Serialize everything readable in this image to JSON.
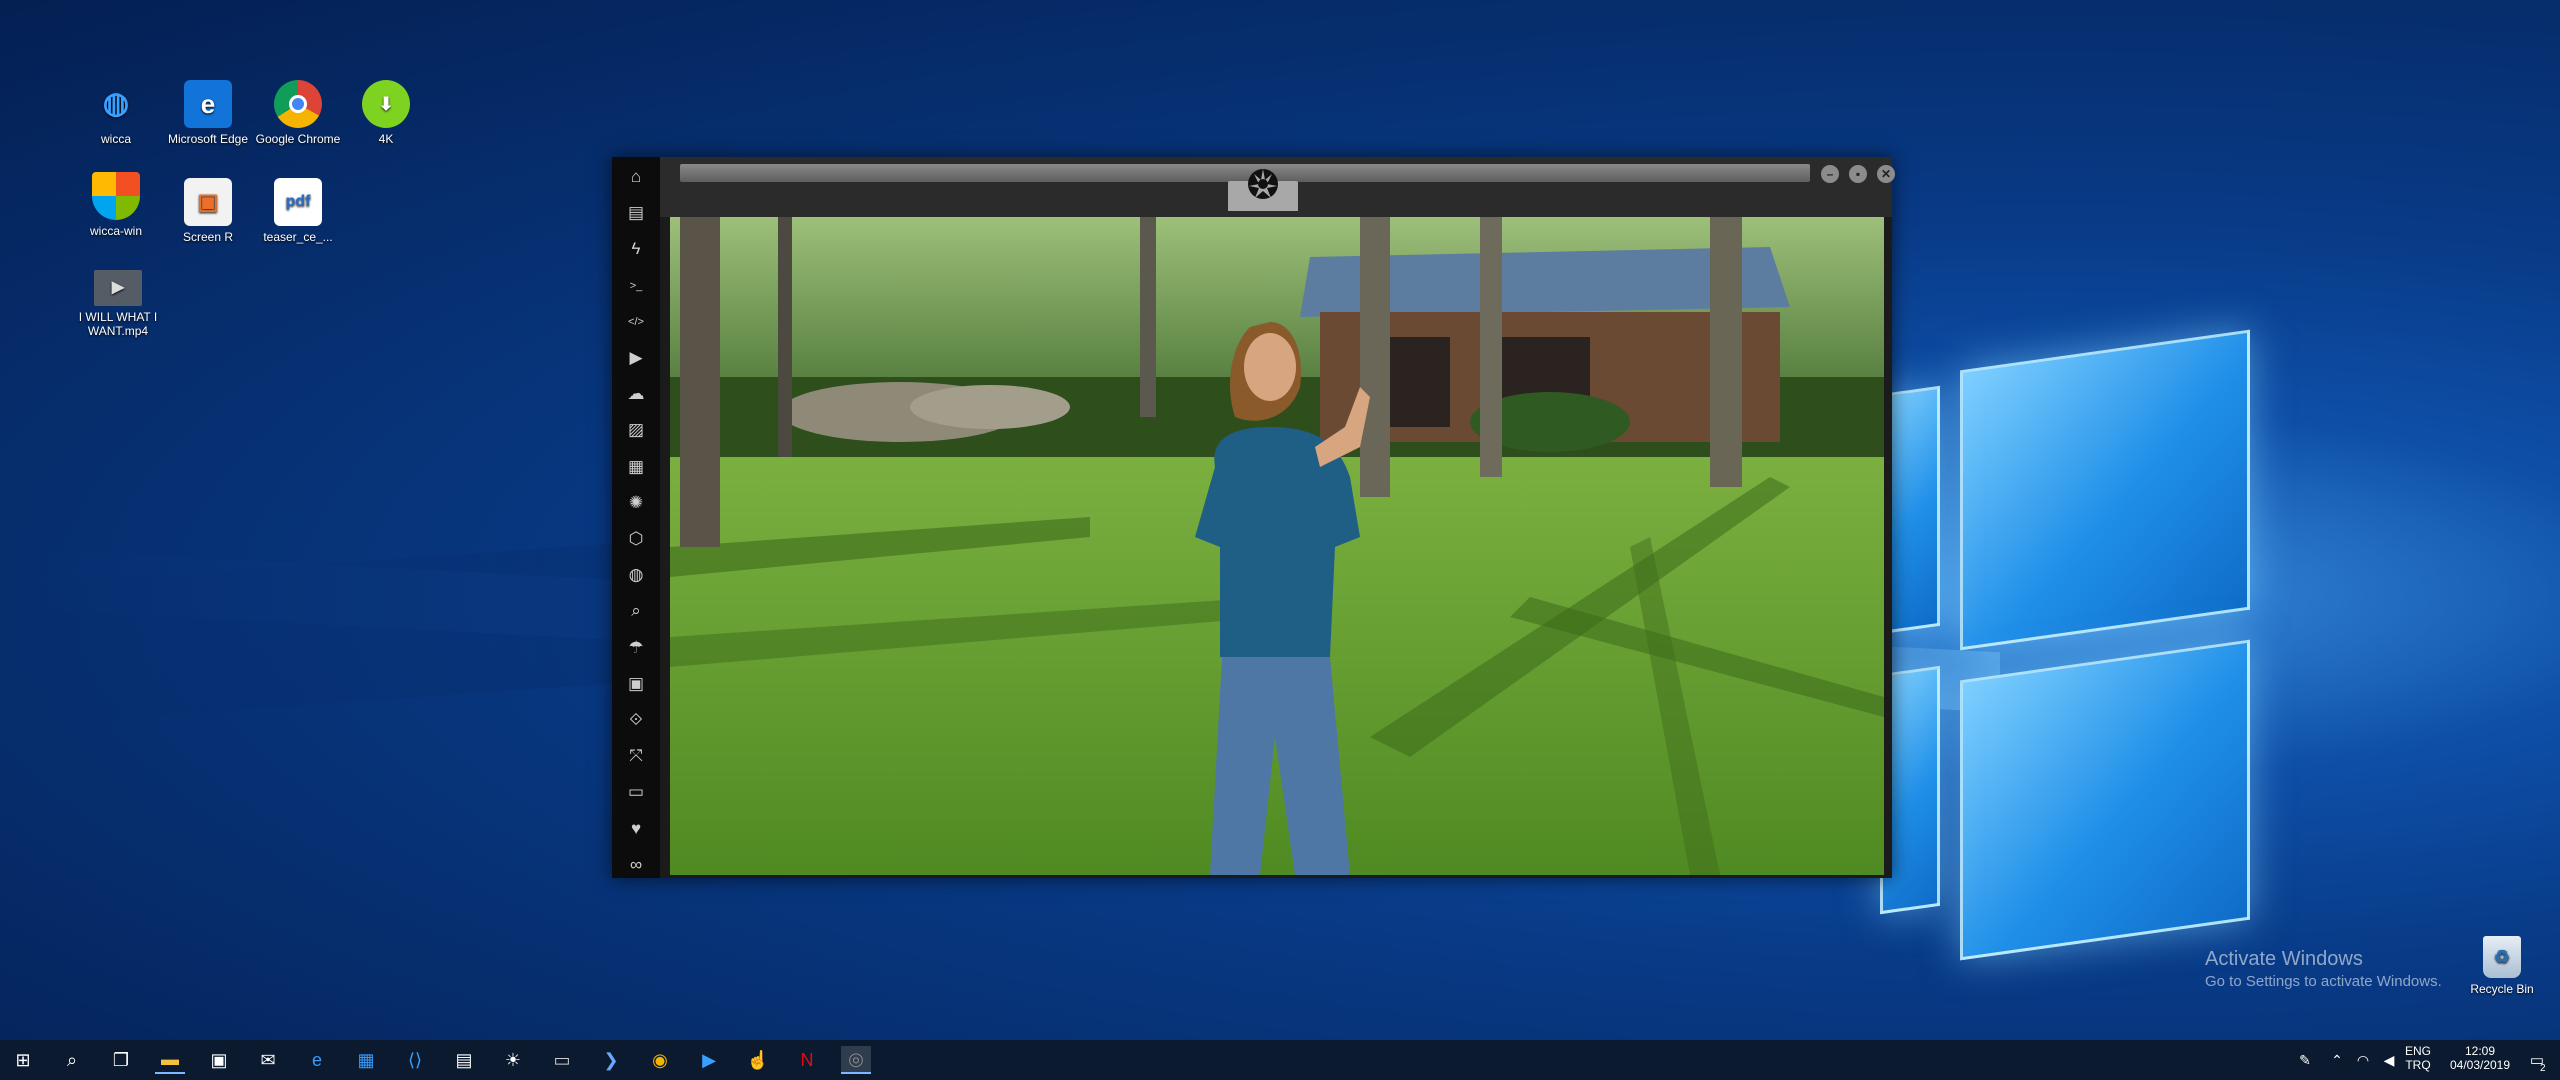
{
  "desktop": {
    "icons": [
      {
        "label": "wicca",
        "icon": "globe-shortcut-icon"
      },
      {
        "label": "Microsoft Edge",
        "icon": "edge-icon"
      },
      {
        "label": "Google Chrome",
        "icon": "chrome-icon"
      },
      {
        "label": "4K",
        "icon": "4k-downloader-icon"
      },
      {
        "label": "wicca-win",
        "icon": "shield-icon"
      },
      {
        "label": "Screen R",
        "icon": "screen-recorder-icon"
      },
      {
        "label": "teaser_ce_...",
        "icon": "pdf-icon"
      },
      {
        "label": "I WILL WHAT I WANT.mp4",
        "icon": "video-file-icon"
      }
    ],
    "recycle_bin": {
      "label": "Recycle Bin"
    },
    "activate": {
      "title": "Activate Windows",
      "subtitle": "Go to Settings to activate Windows."
    }
  },
  "app": {
    "sidebar": [
      {
        "name": "home-icon",
        "glyph": "⌂"
      },
      {
        "name": "document-icon",
        "glyph": "▤"
      },
      {
        "name": "lightning-icon",
        "glyph": "ϟ"
      },
      {
        "name": "terminal-icon",
        "glyph": ">_"
      },
      {
        "name": "code-icon",
        "glyph": "</>"
      },
      {
        "name": "play-icon",
        "glyph": "▶"
      },
      {
        "name": "cloud-icon",
        "glyph": "☁"
      },
      {
        "name": "image-icon",
        "glyph": "▨"
      },
      {
        "name": "newspaper-icon",
        "glyph": "▦"
      },
      {
        "name": "atom-icon",
        "glyph": "✺"
      },
      {
        "name": "hexagon-icon",
        "glyph": "⬡"
      },
      {
        "name": "globe-icon",
        "glyph": "◍"
      },
      {
        "name": "search-icon",
        "glyph": "⌕"
      },
      {
        "name": "umbrella-icon",
        "glyph": "☂"
      },
      {
        "name": "user-badge-icon",
        "glyph": "▣"
      },
      {
        "name": "link-icon",
        "glyph": "⟐"
      },
      {
        "name": "expand-icon",
        "glyph": "⤧"
      },
      {
        "name": "youtube-icon",
        "glyph": "▭"
      },
      {
        "name": "heart-icon",
        "glyph": "♥"
      },
      {
        "name": "infinity-icon",
        "glyph": "∞"
      }
    ],
    "titlebar": {
      "logo": "rebel-alliance-icon"
    },
    "window_buttons": [
      "minimize-icon",
      "maximize-icon",
      "close-icon"
    ]
  },
  "taskbar": {
    "pinned": [
      "start-icon",
      "search-icon",
      "task-view-icon",
      "file-explorer-icon",
      "store-icon",
      "mail-icon",
      "edge-icon",
      "app-icon",
      "vscode-icon",
      "news-icon",
      "weather-icon",
      "terminal-icon",
      "powershell-icon",
      "chrome-icon",
      "media-icon",
      "pointer-icon",
      "netflix-icon",
      "active-app-icon"
    ],
    "tray": {
      "lang_top": "ENG",
      "lang_bottom": "TRQ",
      "time": "12:09",
      "date": "04/03/2019",
      "notification_count": "2"
    }
  }
}
